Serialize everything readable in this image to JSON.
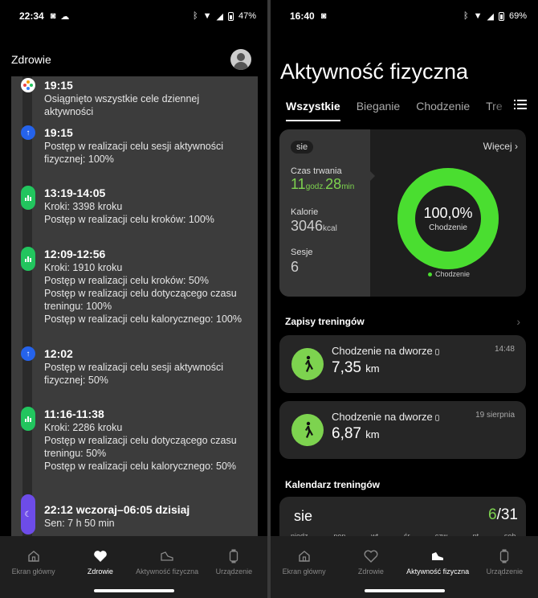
{
  "left": {
    "status": {
      "time": "22:34",
      "battery": "47%"
    },
    "header": {
      "title": "Zdrowie"
    },
    "entries": [
      {
        "time": "19:15",
        "lines": [
          "Osiągnięto wszystkie cele dziennej aktywności"
        ]
      },
      {
        "time": "19:15",
        "lines": [
          "Postęp w realizacji celu sesji aktywności",
          "fizycznej: 100%"
        ]
      },
      {
        "time": "13:19-14:05",
        "lines": [
          "Kroki: 3398 kroku",
          "Postęp w realizacji celu kroków: 100%"
        ]
      },
      {
        "time": "12:09-12:56",
        "lines": [
          "Kroki: 1910 kroku",
          "Postęp w realizacji celu kroków: 50%",
          "Postęp w realizacji celu dotyczącego czasu",
          "treningu: 100%",
          "Postęp w realizacji celu kalorycznego: 100%"
        ]
      },
      {
        "time": "12:02",
        "lines": [
          "Postęp w realizacji celu sesji aktywności",
          "fizycznej: 50%"
        ]
      },
      {
        "time": "11:16-11:38",
        "lines": [
          "Kroki: 2286 kroku",
          "Postęp w realizacji celu dotyczącego czasu",
          "treningu: 50%",
          "Postęp w realizacji celu kalorycznego: 50%"
        ]
      },
      {
        "time": "22:12 wczoraj–06:05 dzisiaj",
        "lines": [
          "Sen: 7 h 50 min"
        ]
      }
    ],
    "nav": [
      {
        "label": "Ekran główny"
      },
      {
        "label": "Zdrowie"
      },
      {
        "label": "Aktywność fizyczna"
      },
      {
        "label": "Urządzenie"
      }
    ]
  },
  "right": {
    "status": {
      "time": "16:40",
      "battery": "69%"
    },
    "title": "Aktywność fizyczna",
    "tabs": [
      "Wszystkie",
      "Bieganie",
      "Chodzenie",
      "Tre"
    ],
    "summary": {
      "period": "sie",
      "more": "Więcej",
      "duration_label": "Czas trwania",
      "duration_h": "11",
      "duration_h_unit": "godz.",
      "duration_m": "28",
      "duration_m_unit": "min",
      "calories_label": "Kalorie",
      "calories_value": "3046",
      "calories_unit": "kcal",
      "sessions_label": "Sesje",
      "sessions_value": "6",
      "ring_percent": "100,0%",
      "ring_fraction": 1.0,
      "ring_label": "Chodzenie",
      "legend": "Chodzenie",
      "ring_color": "#4ade30"
    },
    "records_title": "Zapisy treningów",
    "workouts": [
      {
        "name": "Chodzenie na dworze",
        "distance": "7,35",
        "unit": "km",
        "time": "14:48"
      },
      {
        "name": "Chodzenie na dworze",
        "distance": "6,87",
        "unit": "km",
        "time": "19 sierpnia"
      }
    ],
    "calendar": {
      "title": "Kalendarz treningów",
      "month": "sie",
      "done": "6",
      "total": "/31",
      "days": [
        "niedz.",
        "pon.",
        "wt.",
        "śr.",
        "czw.",
        "pt.",
        "sob."
      ]
    },
    "nav": [
      {
        "label": "Ekran główny"
      },
      {
        "label": "Zdrowie"
      },
      {
        "label": "Aktywność fizyczna"
      },
      {
        "label": "Urządzenie"
      }
    ]
  }
}
